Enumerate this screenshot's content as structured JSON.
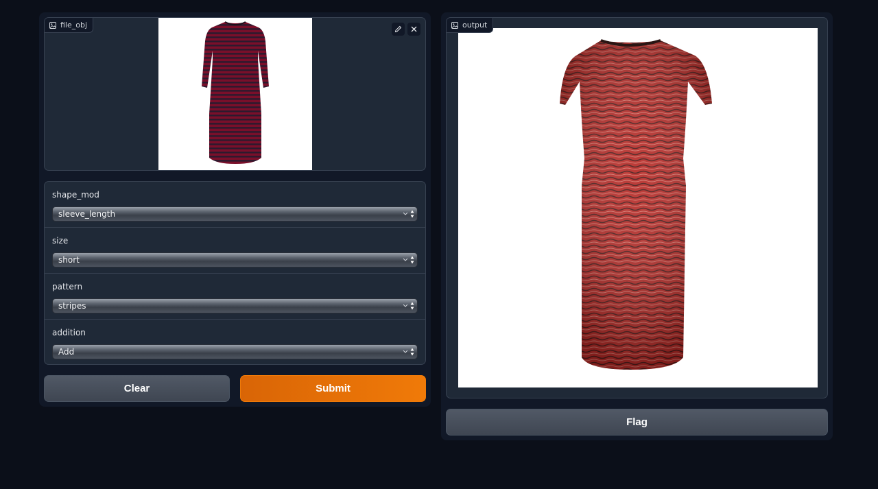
{
  "input_image": {
    "label": "file_obj",
    "icon": "image-icon",
    "tools": [
      "edit-icon",
      "close-icon"
    ]
  },
  "form": {
    "shape_mod": {
      "label": "shape_mod",
      "value": "sleeve_length"
    },
    "size": {
      "label": "size",
      "value": "short"
    },
    "pattern": {
      "label": "pattern",
      "value": "stripes"
    },
    "addition": {
      "label": "addition",
      "value": "Add"
    }
  },
  "buttons": {
    "clear": "Clear",
    "submit": "Submit",
    "flag": "Flag"
  },
  "output_image": {
    "label": "output",
    "icon": "image-icon"
  },
  "colors": {
    "background": "#0b0f19",
    "panel": "#1f2937",
    "accent": "#f07a08"
  }
}
